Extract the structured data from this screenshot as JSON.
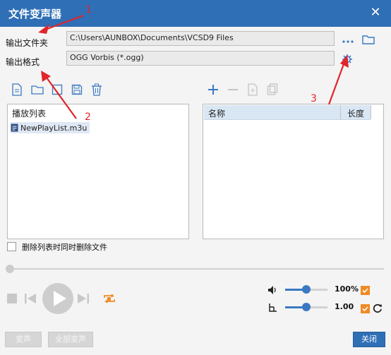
{
  "window": {
    "title": "文件变声器"
  },
  "output": {
    "folder_label": "输出文件夹",
    "folder_value": "C:\\Users\\AUNBOX\\Documents\\VCSD9 Files",
    "format_label": "输出格式",
    "format_value": "OGG Vorbis (*.ogg)"
  },
  "playlist": {
    "header": "播放列表",
    "items": [
      "NewPlayList.m3u"
    ]
  },
  "files": {
    "col_name": "名称",
    "col_length": "长度"
  },
  "options": {
    "delete_label": "删除列表时同时删除文件"
  },
  "volume": {
    "value_text": "100%",
    "level": 0.5
  },
  "speed": {
    "value_text": "1.00",
    "level": 0.5
  },
  "buttons": {
    "convert": "变声",
    "convert_all": "全部变声",
    "close": "关闭"
  },
  "annotations": [
    "1",
    "2",
    "3"
  ],
  "colors": {
    "titlebar": "#2f6fb6",
    "accent": "#3a78c2",
    "annotation": "#e0252b",
    "check": "#f08a24"
  }
}
